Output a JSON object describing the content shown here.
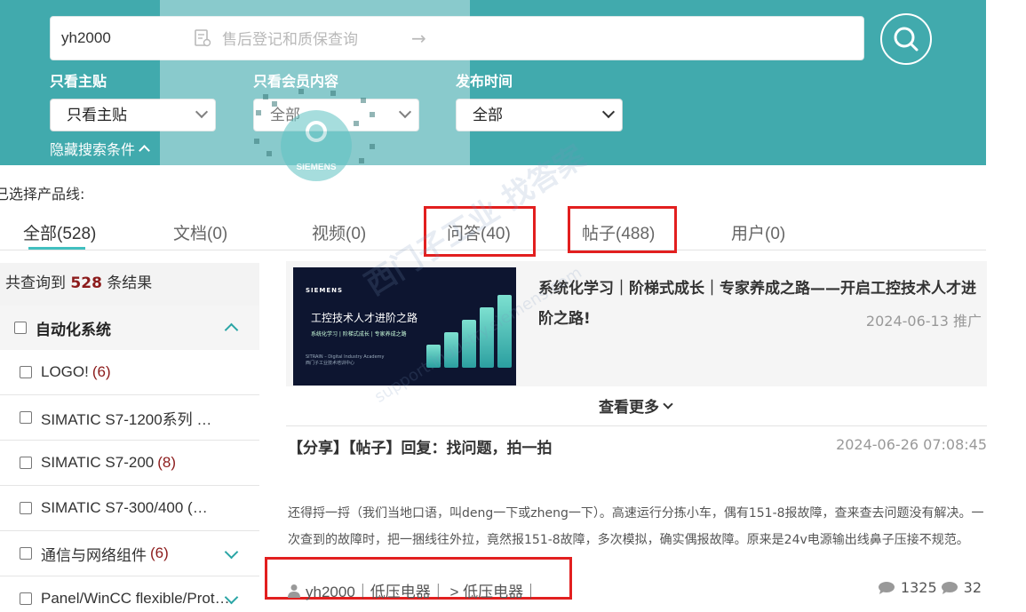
{
  "search": {
    "value": "yh2000"
  },
  "overlay": {
    "link_text": "售后登记和质保查询",
    "arrow": "→",
    "qr_brand": "SIEMENS"
  },
  "filters": [
    {
      "label": "只看主贴",
      "selected": "只看主贴"
    },
    {
      "label": "只看会员内容",
      "selected": "全部"
    },
    {
      "label": "发布时间",
      "selected": "全部"
    }
  ],
  "hide_conditions": "隐藏搜索条件",
  "selected_product_line": "已选择产品线:",
  "tabs": [
    {
      "label": "全部(528)",
      "active": true
    },
    {
      "label": "文档(0)"
    },
    {
      "label": "视频(0)"
    },
    {
      "label": "问答(40)"
    },
    {
      "label": "帖子(488)"
    },
    {
      "label": "用户(0)"
    }
  ],
  "result": {
    "prefix": "共查询到",
    "count": "528",
    "suffix": "条结果"
  },
  "category": {
    "head": "自动化系统",
    "items": [
      {
        "name": "LOGO!",
        "count": "(6)"
      },
      {
        "name": "SIMATIC S7-1200系列 …",
        "count": ""
      },
      {
        "name": "SIMATIC S7-200",
        "count": "(8)"
      },
      {
        "name": "SIMATIC S7-300/400 (…",
        "count": ""
      },
      {
        "name": "通信与网络组件",
        "count": "(6)"
      },
      {
        "name": "Panel/WinCC flexible/Prot…",
        "count": ""
      }
    ]
  },
  "promo": {
    "banner_brand": "SIEMENS",
    "banner_title": "工控技术人才进阶之路",
    "banner_sub": "系统化学习 | 阶梯式成长 | 专家养成之路",
    "banner_foot1": "SITRAIN – Digital Industry Academy",
    "banner_foot2": "西门子工业技术培训中心",
    "title": "系统化学习｜阶梯式成长｜专家养成之路——开启工控技术人才进阶之路!",
    "date": "2024-06-13 推广"
  },
  "more_label": "查看更多",
  "post": {
    "title": "【分享】【帖子】回复：找问题，拍一拍",
    "date": "2024-06-26 07:08:45",
    "body": "还得捋一捋（我们当地口语，叫deng一下或zheng一下）。高速运行分拣小车，偶有151-8报故障，查来查去问题没有解决。一次查到的故障时，把一捆线往外拉，竟然报151-8故障，多次模拟，确实偶报故障。原来是24v电源输出线鼻子压接不规范。",
    "meta": "yh2000｜低压电器｜ > 低压电器｜",
    "views": "1325",
    "replies": "32"
  },
  "watermark": {
    "line1": "西门子工业 找答案",
    "line2": "support.industry.siemens.com"
  },
  "colors": {
    "header_bg": "#41aaad",
    "accent": "#41c0c0",
    "highlight_box": "#e21f1f",
    "count_red": "#8c1b1b"
  }
}
